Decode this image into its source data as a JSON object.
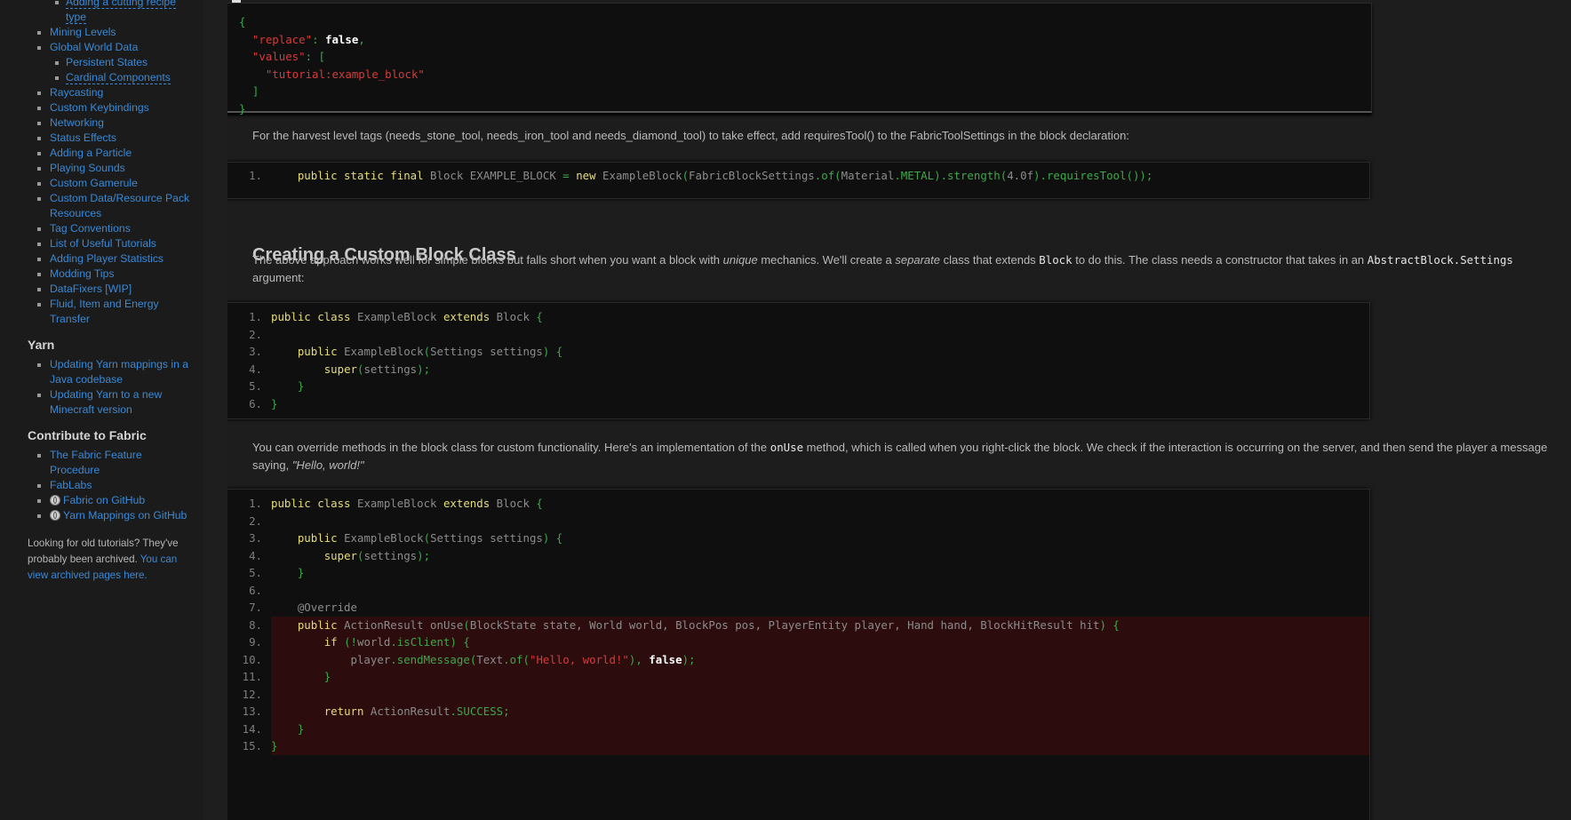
{
  "sidebar": {
    "top_items": [
      {
        "label": "Adding a cutting recipe type",
        "sub": true,
        "dashed": true
      },
      {
        "label": "Mining Levels",
        "sub": false
      },
      {
        "label": "Global World Data",
        "sub": false
      },
      {
        "label": "Persistent States",
        "sub": true
      },
      {
        "label": "Cardinal Components",
        "sub": true,
        "dashed": true
      },
      {
        "label": "Raycasting",
        "sub": false
      },
      {
        "label": "Custom Keybindings",
        "sub": false
      },
      {
        "label": "Networking",
        "sub": false
      },
      {
        "label": "Status Effects",
        "sub": false
      },
      {
        "label": "Adding a Particle",
        "sub": false
      },
      {
        "label": "Playing Sounds",
        "sub": false
      },
      {
        "label": "Custom Gamerule",
        "sub": false
      },
      {
        "label": "Custom Data/Resource Pack Resources",
        "sub": false
      },
      {
        "label": "Tag Conventions",
        "sub": false
      },
      {
        "label": "List of Useful Tutorials",
        "sub": false
      },
      {
        "label": "Adding Player Statistics",
        "sub": false
      },
      {
        "label": "Modding Tips",
        "sub": false
      },
      {
        "label": "DataFixers [WIP]",
        "sub": false
      },
      {
        "label": "Fluid, Item and Energy Transfer",
        "sub": false
      }
    ],
    "yarn_heading": "Yarn",
    "yarn_items": [
      {
        "label": "Updating Yarn mappings in a Java codebase"
      },
      {
        "label": "Updating Yarn to a new Minecraft version"
      }
    ],
    "contribute_heading": "Contribute to Fabric",
    "contribute_items": [
      {
        "label": "The Fabric Feature Procedure",
        "icon": ""
      },
      {
        "label": "FabLabs",
        "icon": ""
      },
      {
        "label": "Fabric on GitHub",
        "icon": "github-globe-icon"
      },
      {
        "label": "Yarn Mappings on GitHub",
        "icon": "github-globe-icon"
      }
    ],
    "archive_note": "Looking for old tutorials? They've probably been archived.",
    "archive_link": "You can view archived pages here."
  },
  "content": {
    "json_lines": [
      "{",
      "  \"replace\": false,",
      "  \"values\": [",
      "    \"tutorial:example_block\"",
      "  ]",
      "}"
    ],
    "para1": "For the harvest level tags (needs_stone_tool, needs_iron_tool and needs_diamond_tool) to take effect, add requiresTool() to the FabricToolSettings in the block declaration:",
    "code1_num": "1.",
    "heading": "Creating a Custom Block Class",
    "para2_a": "The above approach works well for simple blocks but falls short when you want a block with ",
    "para2_em1": "unique",
    "para2_b": " mechanics. We'll create a ",
    "para2_em2": "separate",
    "para2_c": " class that extends ",
    "para2_code1": "Block",
    "para2_d": " to do this. The class needs a constructor that takes in an ",
    "para2_code2": "AbstractBlock.Settings",
    "para2_e": " argument:",
    "para3_a": "You can override methods in the block class for custom functionality. Here's an implementation of the ",
    "para3_code": "onUse",
    "para3_b": " method, which is called when you right-click the block. We check if the interaction is occurring on the server, and then send the player a message saying, ",
    "para3_em": "\"Hello, world!\""
  }
}
